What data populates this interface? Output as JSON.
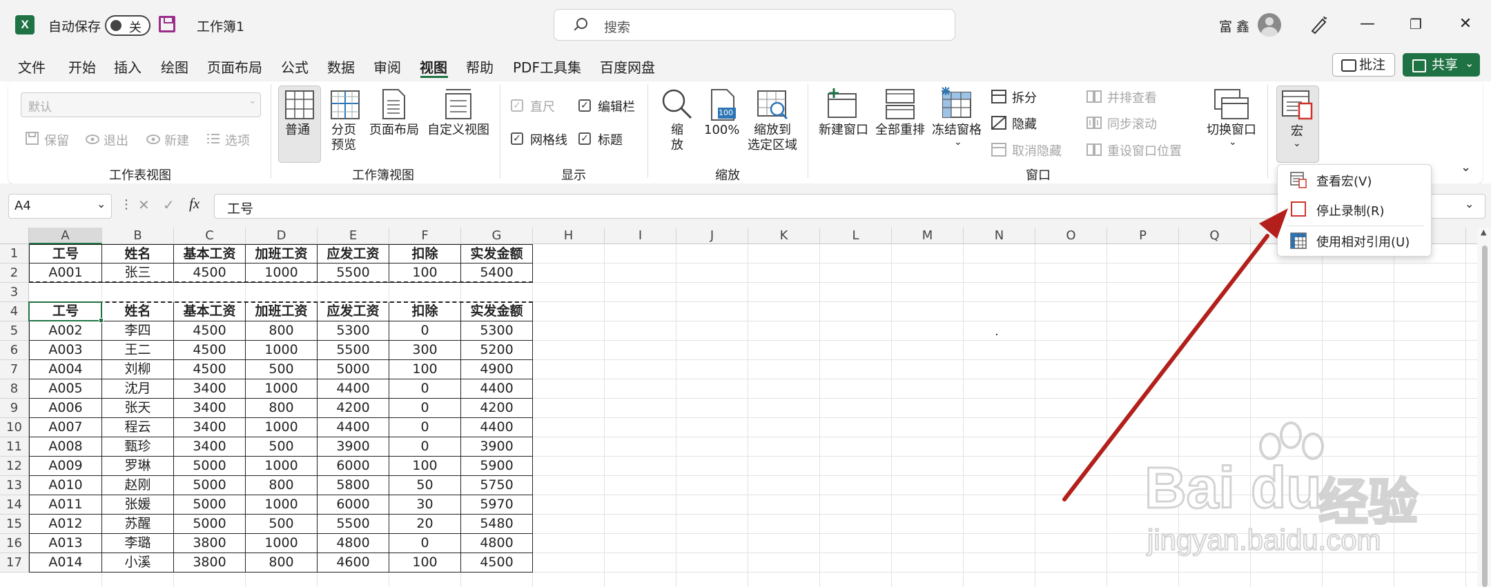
{
  "titlebar": {
    "app_icon": "X",
    "autosave_label": "自动保存",
    "autosave_state": "关",
    "workbook_name": "工作簿1",
    "search_placeholder": "搜索",
    "user_name": "富 鑫",
    "minimize": "—",
    "restore": "❐",
    "close": "✕"
  },
  "menu": {
    "tabs": [
      "文件",
      "开始",
      "插入",
      "绘图",
      "页面布局",
      "公式",
      "数据",
      "审阅",
      "视图",
      "帮助",
      "PDF工具集",
      "百度网盘"
    ],
    "active_tab": "视图",
    "comment_label": "批注",
    "share_label": "共享"
  },
  "ribbon": {
    "sheet_view": {
      "select_value": "默认",
      "keep": "保留",
      "exit": "退出",
      "new": "新建",
      "options": "选项",
      "group_label": "工作表视图"
    },
    "workbook_view": {
      "normal": "普通",
      "page_break_1": "分页",
      "page_break_2": "预览",
      "page_layout": "页面布局",
      "custom_view": "自定义视图",
      "group_label": "工作簿视图"
    },
    "show": {
      "ruler": "直尺",
      "formula_bar": "编辑栏",
      "gridlines": "网格线",
      "headings": "标题",
      "group_label": "显示"
    },
    "zoom": {
      "zoom_1": "缩",
      "zoom_2": "放",
      "pct_icon": "100",
      "pct": "100%",
      "to_sel_1": "缩放到",
      "to_sel_2": "选定区域",
      "group_label": "缩放"
    },
    "window": {
      "new_window": "新建窗口",
      "arrange_all": "全部重排",
      "freeze": "冻结窗格",
      "split": "拆分",
      "hide": "隐藏",
      "unhide": "取消隐藏",
      "side_by_side": "并排查看",
      "sync_scroll": "同步滚动",
      "reset_pos": "重设窗口位置",
      "switch": "切换窗口",
      "group_label": "窗口"
    },
    "macros": {
      "label": "宏"
    }
  },
  "formula_bar": {
    "name_box": "A4",
    "fx": "fx",
    "cancel": "✕",
    "enter": "✓",
    "value": "工号"
  },
  "macro_menu": {
    "items": [
      "查看宏(V)",
      "停止录制(R)",
      "使用相对引用(U)"
    ]
  },
  "sheet": {
    "columns": [
      "A",
      "B",
      "C",
      "D",
      "E",
      "F",
      "G",
      "H",
      "I",
      "J",
      "K",
      "L",
      "M",
      "N",
      "O",
      "P",
      "Q"
    ],
    "rows": [
      "1",
      "2",
      "3",
      "4",
      "5",
      "6",
      "7",
      "8",
      "9",
      "10",
      "11",
      "12",
      "13",
      "14",
      "15",
      "16",
      "17"
    ],
    "data": [
      [
        "工号",
        "姓名",
        "基本工资",
        "加班工资",
        "应发工资",
        "扣除",
        "实发金额"
      ],
      [
        "A001",
        "张三",
        "4500",
        "1000",
        "5500",
        "100",
        "5400"
      ],
      [
        "",
        "",
        "",
        "",
        "",
        "",
        ""
      ],
      [
        "工号",
        "姓名",
        "基本工资",
        "加班工资",
        "应发工资",
        "扣除",
        "实发金额"
      ],
      [
        "A002",
        "李四",
        "4500",
        "800",
        "5300",
        "0",
        "5300"
      ],
      [
        "A003",
        "王二",
        "4500",
        "1000",
        "5500",
        "300",
        "5200"
      ],
      [
        "A004",
        "刘柳",
        "4500",
        "500",
        "5000",
        "100",
        "4900"
      ],
      [
        "A005",
        "沈月",
        "3400",
        "1000",
        "4400",
        "0",
        "4400"
      ],
      [
        "A006",
        "张天",
        "3400",
        "800",
        "4200",
        "0",
        "4200"
      ],
      [
        "A007",
        "程云",
        "3400",
        "1000",
        "4400",
        "0",
        "4400"
      ],
      [
        "A008",
        "甄珍",
        "3400",
        "500",
        "3900",
        "0",
        "3900"
      ],
      [
        "A009",
        "罗琳",
        "5000",
        "1000",
        "6000",
        "100",
        "5900"
      ],
      [
        "A010",
        "赵刚",
        "5000",
        "800",
        "5800",
        "50",
        "5750"
      ],
      [
        "A011",
        "张媛",
        "5000",
        "1000",
        "6000",
        "30",
        "5970"
      ],
      [
        "A012",
        "苏醒",
        "5000",
        "500",
        "5500",
        "20",
        "5480"
      ],
      [
        "A013",
        "李璐",
        "3800",
        "1000",
        "4800",
        "0",
        "4800"
      ],
      [
        "A014",
        "小溪",
        "3800",
        "800",
        "4600",
        "100",
        "4500"
      ]
    ]
  },
  "watermark": {
    "brand": "Bai",
    "brand2": "du",
    "cn": "经验",
    "url": "jingyan.baidu.com"
  },
  "colors": {
    "excel_green": "#1f7244",
    "arrow_red": "#b3201c",
    "macro_purple": "#9b2d8a"
  }
}
